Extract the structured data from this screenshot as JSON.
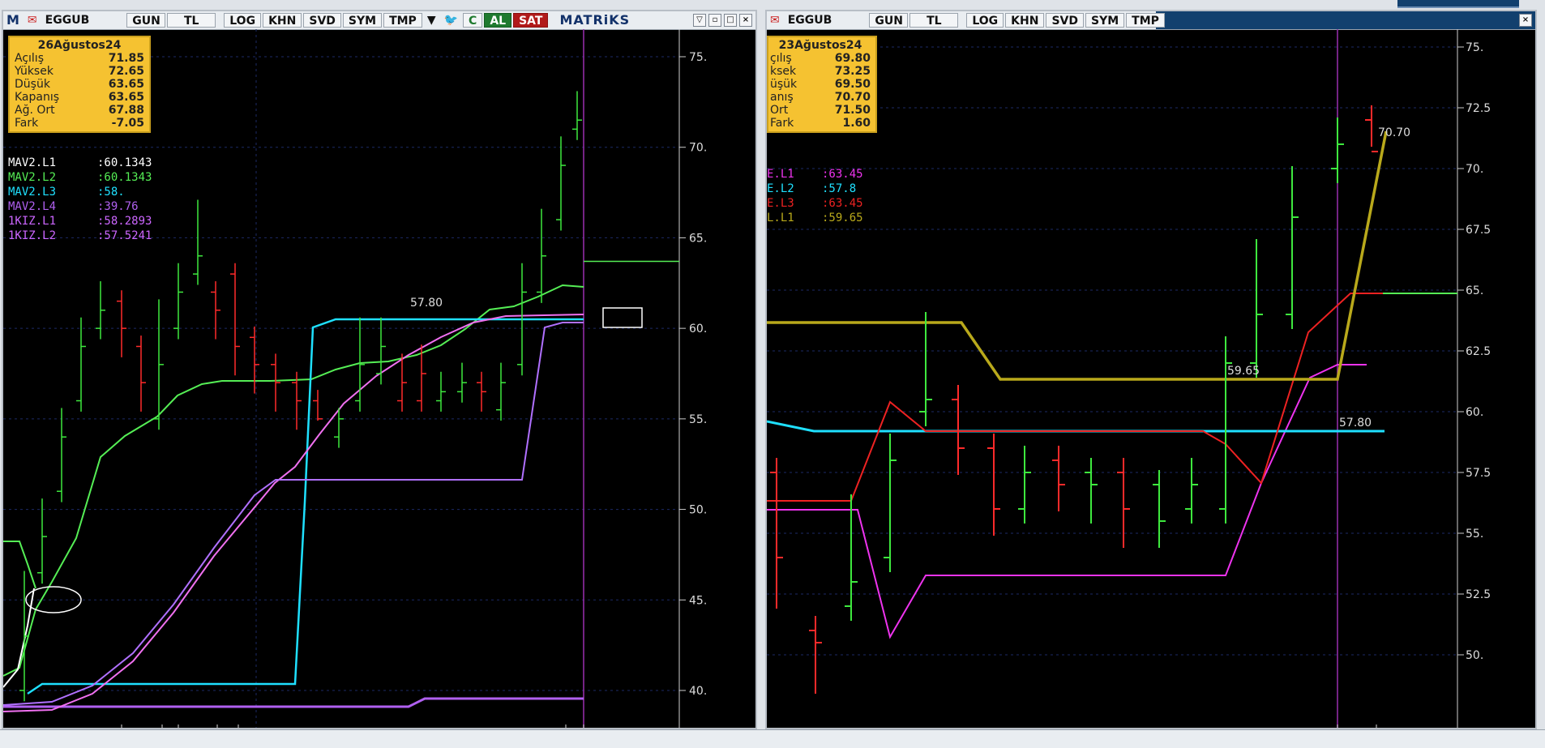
{
  "colors": {
    "bg": "#000000",
    "up": "#3ee83e",
    "down": "#ff2a2a",
    "cyan": "#1fe0ff",
    "violet": "#b060f0",
    "pink": "#f070f0",
    "white": "#ffffff",
    "green": "#55ee55",
    "olive": "#b9a91b",
    "magenta": "#ee33ee",
    "red": "#ee2222",
    "info": "#f5c231"
  },
  "left": {
    "toolbar": {
      "symbol": "EGGUB",
      "items": [
        "GUN",
        "TL",
        "LOG",
        "KHN",
        "SVD",
        "SYM",
        "TMP"
      ],
      "al": "AL",
      "sat": "SAT",
      "brand": "MATRiKS",
      "logo": "matriks-m-icon"
    },
    "info": {
      "date": "26Ağustos24",
      "rows": [
        {
          "label": "Açılış",
          "value": "71.85"
        },
        {
          "label": "Yüksek",
          "value": "72.65"
        },
        {
          "label": "Düşük",
          "value": "63.65"
        },
        {
          "label": "Kapanış",
          "value": "63.65"
        },
        {
          "label": "Ağ. Ort",
          "value": "67.88"
        },
        {
          "label": "Fark",
          "value": "-7.05"
        }
      ]
    },
    "legend": [
      {
        "name": "MAV2.L1",
        "value": ":60.1343",
        "color": "#ffffff"
      },
      {
        "name": "MAV2.L2",
        "value": ":60.1343",
        "color": "#55ee55"
      },
      {
        "name": "MAV2.L3",
        "value": ":58.",
        "color": "#1fe0ff"
      },
      {
        "name": "MAV2.L4",
        "value": ":39.76",
        "color": "#b060f0"
      },
      {
        "name": "1KIZ.L1",
        "value": ":58.2893",
        "color": "#cc66ff"
      },
      {
        "name": "1KIZ.L2",
        "value": ":57.5241",
        "color": "#cc66ff"
      }
    ],
    "axis_labels": [
      "75.",
      "70.",
      "65.",
      "60.",
      "55.",
      "50.",
      "45.",
      "40."
    ],
    "annotation": "57.80"
  },
  "right": {
    "toolbar": {
      "symbol": "EGGUB",
      "items": [
        "GUN",
        "TL",
        "LOG",
        "KHN",
        "SVD",
        "SYM",
        "TMP"
      ]
    },
    "info": {
      "date": "23Ağustos24",
      "rows": [
        {
          "label": "çılış",
          "value": "69.80"
        },
        {
          "label": "ksek",
          "value": "73.25"
        },
        {
          "label": "üşük",
          "value": "69.50"
        },
        {
          "label": "anış",
          "value": "70.70"
        },
        {
          "label": "Ort",
          "value": "71.50"
        },
        {
          "label": "Fark",
          "value": "1.60"
        }
      ]
    },
    "legend": [
      {
        "name": "E.L1",
        "value": ":63.45",
        "color": "#ee33ee"
      },
      {
        "name": "E.L2",
        "value": ":57.8",
        "color": "#1fe0ff"
      },
      {
        "name": "E.L3",
        "value": ":63.45",
        "color": "#ee2222"
      },
      {
        "name": "L.L1",
        "value": ":59.65",
        "color": "#b9a91b"
      }
    ],
    "axis_labels": [
      "75.",
      "72.5",
      "70.",
      "67.5",
      "65.",
      "62.5",
      "60.",
      "57.5",
      "55.",
      "52.5",
      "50."
    ],
    "annotations": {
      "olive": "59.65",
      "cyan": "57.80",
      "close": "70.70"
    }
  }
}
